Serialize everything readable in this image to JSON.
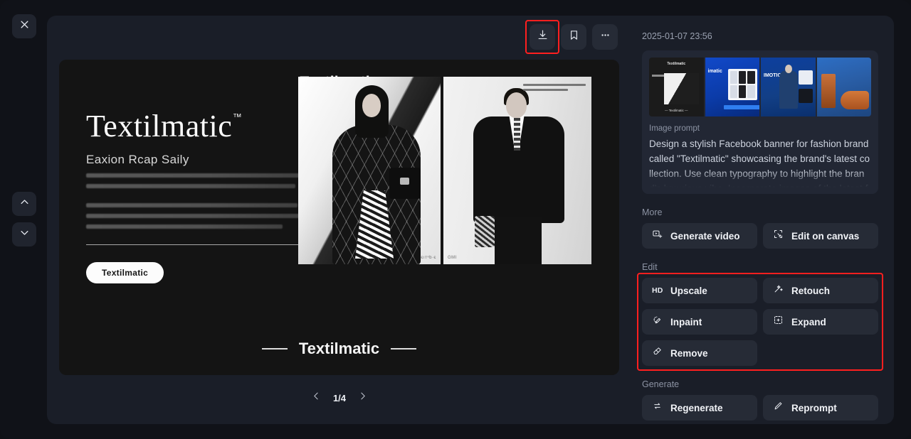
{
  "left_rail": {
    "close_icon": "close-icon",
    "up_icon": "chevron-up-icon",
    "down_icon": "chevron-down-icon"
  },
  "toolbar": {
    "download_label": "Download",
    "bookmark_label": "Bookmark",
    "more_label": "More options"
  },
  "image": {
    "top_title": "Textilmatic",
    "headline": "Textilmatic",
    "trademark": "™",
    "subhead": "Eaxion Rcap Saily",
    "pill_label": "Textilmatic",
    "bottom_title": "Textilmatic",
    "photo_left_mark": "єıтᵊb·є",
    "photo_right_mark": "GMI"
  },
  "pager": {
    "label": "1/4",
    "prev_icon": "chevron-left-icon",
    "next_icon": "chevron-right-icon"
  },
  "panel": {
    "timestamp": "2025-01-07 23:56",
    "prompt_label": "Image prompt",
    "prompt_text": "Design a stylish Facebook banner for fashion brand called \"Textilmatic\" showcasing the brand's latest collection. Use clean typography to highlight the brand’s luxurious vibe. Incorporate images of the latest fashion items.",
    "thumbnails": [
      {
        "name": "thumbnail-dark-banner",
        "top_text": "Textilmatic",
        "bottom_text": "— Textilmatic —"
      },
      {
        "name": "thumbnail-blue-laptop",
        "heading": "imatic"
      },
      {
        "name": "thumbnail-blue-model",
        "heading": "IMOTIC"
      },
      {
        "name": "thumbnail-orange-shoes",
        "heading": ""
      }
    ],
    "sections": {
      "more": {
        "label": "More",
        "buttons": [
          {
            "label": "Generate video",
            "icon": "video-frame-icon"
          },
          {
            "label": "Edit on canvas",
            "icon": "canvas-frame-icon"
          }
        ]
      },
      "edit": {
        "label": "Edit",
        "highlighted": true,
        "buttons": [
          {
            "label": "Upscale",
            "icon": "hd-badge-icon"
          },
          {
            "label": "Retouch",
            "icon": "magic-wand-icon"
          },
          {
            "label": "Inpaint",
            "icon": "brush-dashed-icon"
          },
          {
            "label": "Expand",
            "icon": "expand-frame-icon"
          },
          {
            "label": "Remove",
            "icon": "eraser-icon"
          }
        ]
      },
      "generate": {
        "label": "Generate",
        "buttons": [
          {
            "label": "Regenerate",
            "icon": "refresh-loop-icon"
          },
          {
            "label": "Reprompt",
            "icon": "pencil-icon"
          }
        ]
      }
    }
  },
  "colors": {
    "app_bg": "#101218",
    "modal_bg": "#1a1e28",
    "button_bg": "#262b36",
    "card_bg": "#222734",
    "highlight": "#ff1f1f",
    "text_primary": "#f1f3f7",
    "text_muted": "#8c93a3"
  }
}
